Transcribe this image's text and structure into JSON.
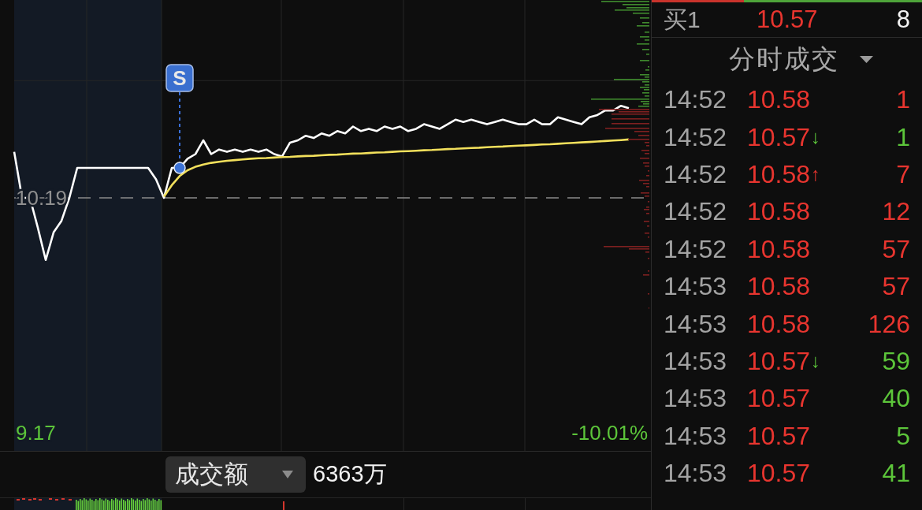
{
  "price_chart": {
    "chart_data": {
      "type": "line",
      "categories": [
        null,
        null,
        null,
        null,
        null,
        null,
        null,
        null,
        null,
        null,
        null,
        null,
        null,
        null,
        null,
        null,
        null,
        null,
        null,
        null,
        null,
        null,
        null,
        null,
        null,
        null,
        null,
        null,
        null,
        null,
        null,
        null,
        null,
        null,
        null,
        null,
        null,
        null,
        null,
        null,
        null,
        null,
        null,
        null,
        null,
        null,
        null,
        null,
        null,
        null,
        null,
        null,
        null,
        null,
        null,
        null,
        null,
        null,
        null,
        null,
        null,
        null,
        null,
        null,
        null,
        null,
        null,
        null,
        null,
        null,
        null,
        null,
        null,
        null,
        null,
        null,
        null,
        null,
        null,
        null,
        null
      ],
      "series": [
        {
          "color": "#ffffff",
          "values": [
            10.39,
            10.19,
            10.19,
            10.06,
            9.92,
            10.04,
            10.09,
            10.19,
            10.32,
            10.32,
            10.32,
            10.32,
            10.32,
            10.32,
            10.32,
            10.32,
            10.32,
            10.32,
            10.27,
            10.19,
            10.32,
            10.32,
            10.36,
            10.38,
            10.44,
            10.38,
            10.4,
            10.39,
            10.4,
            10.39,
            10.4,
            10.39,
            10.4,
            10.38,
            10.37,
            10.43,
            10.44,
            10.46,
            10.45,
            10.47,
            10.46,
            10.48,
            10.47,
            10.5,
            10.48,
            10.49,
            10.48,
            10.5,
            10.49,
            10.5,
            10.48,
            10.49,
            10.51,
            10.5,
            10.49,
            10.51,
            10.53,
            10.52,
            10.53,
            10.52,
            10.51,
            10.52,
            10.53,
            10.52,
            10.51,
            10.51,
            10.53,
            10.51,
            10.51,
            10.54,
            10.53,
            10.52,
            10.51,
            10.54,
            10.55,
            10.57,
            10.57,
            10.59,
            10.58,
            null,
            null
          ]
        },
        {
          "color": "#f2e05c",
          "values": [
            null,
            null,
            null,
            null,
            null,
            null,
            null,
            null,
            null,
            null,
            null,
            null,
            null,
            null,
            null,
            null,
            null,
            null,
            null,
            10.195,
            10.245,
            10.285,
            10.31,
            10.325,
            10.335,
            10.342,
            10.347,
            10.351,
            10.354,
            10.357,
            10.36,
            10.362,
            10.363,
            10.365,
            10.367,
            10.368,
            10.37,
            10.372,
            10.373,
            10.375,
            10.377,
            10.378,
            10.38,
            10.382,
            10.383,
            10.385,
            10.387,
            10.388,
            10.39,
            10.392,
            10.393,
            10.395,
            10.397,
            10.398,
            10.4,
            10.402,
            10.403,
            10.405,
            10.407,
            10.408,
            10.41,
            10.412,
            10.413,
            10.415,
            10.417,
            10.418,
            10.42,
            10.422,
            10.423,
            10.425,
            10.427,
            10.429,
            10.431,
            10.433,
            10.435,
            10.437,
            10.439,
            10.441,
            10.444,
            null,
            null
          ]
        }
      ],
      "ylim": [
        9.09,
        11.05
      ],
      "yticks": [
        {
          "value": 9.17,
          "label": "9.17"
        },
        {
          "value": 10.19,
          "label": "10.19"
        }
      ],
      "ref_lines": [
        {
          "axis": "y",
          "value": 10.19
        }
      ]
    },
    "low_percent": "-10.01%",
    "signal_label": "S"
  },
  "turnover": {
    "selector": "成交额",
    "value": "6363万"
  },
  "buy_sell_bar": {
    "level": 0.34
  },
  "bid": {
    "label": "买1",
    "price": "10.57",
    "volume": "8"
  },
  "trades_header": {
    "title": "分时成交"
  },
  "trades": [
    {
      "time": "14:52",
      "price": "10.58",
      "volume": "1",
      "color": "#e8352f"
    },
    {
      "time": "14:52",
      "price": "10.57",
      "arrow": "↓",
      "volume": "1",
      "color": "#5cc53a"
    },
    {
      "time": "14:52",
      "price": "10.58",
      "arrow": "↑",
      "volume": "7",
      "color": "#e8352f"
    },
    {
      "time": "14:52",
      "price": "10.58",
      "volume": "12",
      "color": "#e8352f"
    },
    {
      "time": "14:52",
      "price": "10.58",
      "volume": "57",
      "color": "#e8352f"
    },
    {
      "time": "14:53",
      "price": "10.58",
      "volume": "57",
      "color": "#e8352f"
    },
    {
      "time": "14:53",
      "price": "10.58",
      "volume": "126",
      "color": "#e8352f"
    },
    {
      "time": "14:53",
      "price": "10.57",
      "arrow": "↓",
      "volume": "59",
      "color": "#5cc53a"
    },
    {
      "time": "14:53",
      "price": "10.57",
      "volume": "40",
      "color": "#5cc53a"
    },
    {
      "time": "14:53",
      "price": "10.57",
      "volume": "5",
      "color": "#5cc53a"
    },
    {
      "time": "14:53",
      "price": "10.57",
      "volume": "41",
      "color": "#5cc53a"
    }
  ]
}
